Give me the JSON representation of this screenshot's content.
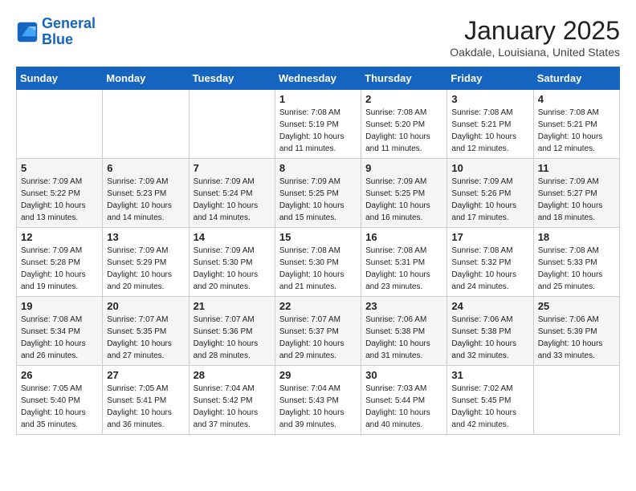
{
  "logo": {
    "line1": "General",
    "line2": "Blue"
  },
  "title": "January 2025",
  "location": "Oakdale, Louisiana, United States",
  "weekdays": [
    "Sunday",
    "Monday",
    "Tuesday",
    "Wednesday",
    "Thursday",
    "Friday",
    "Saturday"
  ],
  "weeks": [
    [
      {
        "day": "",
        "sunrise": "",
        "sunset": "",
        "daylight": ""
      },
      {
        "day": "",
        "sunrise": "",
        "sunset": "",
        "daylight": ""
      },
      {
        "day": "",
        "sunrise": "",
        "sunset": "",
        "daylight": ""
      },
      {
        "day": "1",
        "sunrise": "Sunrise: 7:08 AM",
        "sunset": "Sunset: 5:19 PM",
        "daylight": "Daylight: 10 hours and 11 minutes."
      },
      {
        "day": "2",
        "sunrise": "Sunrise: 7:08 AM",
        "sunset": "Sunset: 5:20 PM",
        "daylight": "Daylight: 10 hours and 11 minutes."
      },
      {
        "day": "3",
        "sunrise": "Sunrise: 7:08 AM",
        "sunset": "Sunset: 5:21 PM",
        "daylight": "Daylight: 10 hours and 12 minutes."
      },
      {
        "day": "4",
        "sunrise": "Sunrise: 7:08 AM",
        "sunset": "Sunset: 5:21 PM",
        "daylight": "Daylight: 10 hours and 12 minutes."
      }
    ],
    [
      {
        "day": "5",
        "sunrise": "Sunrise: 7:09 AM",
        "sunset": "Sunset: 5:22 PM",
        "daylight": "Daylight: 10 hours and 13 minutes."
      },
      {
        "day": "6",
        "sunrise": "Sunrise: 7:09 AM",
        "sunset": "Sunset: 5:23 PM",
        "daylight": "Daylight: 10 hours and 14 minutes."
      },
      {
        "day": "7",
        "sunrise": "Sunrise: 7:09 AM",
        "sunset": "Sunset: 5:24 PM",
        "daylight": "Daylight: 10 hours and 14 minutes."
      },
      {
        "day": "8",
        "sunrise": "Sunrise: 7:09 AM",
        "sunset": "Sunset: 5:25 PM",
        "daylight": "Daylight: 10 hours and 15 minutes."
      },
      {
        "day": "9",
        "sunrise": "Sunrise: 7:09 AM",
        "sunset": "Sunset: 5:25 PM",
        "daylight": "Daylight: 10 hours and 16 minutes."
      },
      {
        "day": "10",
        "sunrise": "Sunrise: 7:09 AM",
        "sunset": "Sunset: 5:26 PM",
        "daylight": "Daylight: 10 hours and 17 minutes."
      },
      {
        "day": "11",
        "sunrise": "Sunrise: 7:09 AM",
        "sunset": "Sunset: 5:27 PM",
        "daylight": "Daylight: 10 hours and 18 minutes."
      }
    ],
    [
      {
        "day": "12",
        "sunrise": "Sunrise: 7:09 AM",
        "sunset": "Sunset: 5:28 PM",
        "daylight": "Daylight: 10 hours and 19 minutes."
      },
      {
        "day": "13",
        "sunrise": "Sunrise: 7:09 AM",
        "sunset": "Sunset: 5:29 PM",
        "daylight": "Daylight: 10 hours and 20 minutes."
      },
      {
        "day": "14",
        "sunrise": "Sunrise: 7:09 AM",
        "sunset": "Sunset: 5:30 PM",
        "daylight": "Daylight: 10 hours and 20 minutes."
      },
      {
        "day": "15",
        "sunrise": "Sunrise: 7:08 AM",
        "sunset": "Sunset: 5:30 PM",
        "daylight": "Daylight: 10 hours and 21 minutes."
      },
      {
        "day": "16",
        "sunrise": "Sunrise: 7:08 AM",
        "sunset": "Sunset: 5:31 PM",
        "daylight": "Daylight: 10 hours and 23 minutes."
      },
      {
        "day": "17",
        "sunrise": "Sunrise: 7:08 AM",
        "sunset": "Sunset: 5:32 PM",
        "daylight": "Daylight: 10 hours and 24 minutes."
      },
      {
        "day": "18",
        "sunrise": "Sunrise: 7:08 AM",
        "sunset": "Sunset: 5:33 PM",
        "daylight": "Daylight: 10 hours and 25 minutes."
      }
    ],
    [
      {
        "day": "19",
        "sunrise": "Sunrise: 7:08 AM",
        "sunset": "Sunset: 5:34 PM",
        "daylight": "Daylight: 10 hours and 26 minutes."
      },
      {
        "day": "20",
        "sunrise": "Sunrise: 7:07 AM",
        "sunset": "Sunset: 5:35 PM",
        "daylight": "Daylight: 10 hours and 27 minutes."
      },
      {
        "day": "21",
        "sunrise": "Sunrise: 7:07 AM",
        "sunset": "Sunset: 5:36 PM",
        "daylight": "Daylight: 10 hours and 28 minutes."
      },
      {
        "day": "22",
        "sunrise": "Sunrise: 7:07 AM",
        "sunset": "Sunset: 5:37 PM",
        "daylight": "Daylight: 10 hours and 29 minutes."
      },
      {
        "day": "23",
        "sunrise": "Sunrise: 7:06 AM",
        "sunset": "Sunset: 5:38 PM",
        "daylight": "Daylight: 10 hours and 31 minutes."
      },
      {
        "day": "24",
        "sunrise": "Sunrise: 7:06 AM",
        "sunset": "Sunset: 5:38 PM",
        "daylight": "Daylight: 10 hours and 32 minutes."
      },
      {
        "day": "25",
        "sunrise": "Sunrise: 7:06 AM",
        "sunset": "Sunset: 5:39 PM",
        "daylight": "Daylight: 10 hours and 33 minutes."
      }
    ],
    [
      {
        "day": "26",
        "sunrise": "Sunrise: 7:05 AM",
        "sunset": "Sunset: 5:40 PM",
        "daylight": "Daylight: 10 hours and 35 minutes."
      },
      {
        "day": "27",
        "sunrise": "Sunrise: 7:05 AM",
        "sunset": "Sunset: 5:41 PM",
        "daylight": "Daylight: 10 hours and 36 minutes."
      },
      {
        "day": "28",
        "sunrise": "Sunrise: 7:04 AM",
        "sunset": "Sunset: 5:42 PM",
        "daylight": "Daylight: 10 hours and 37 minutes."
      },
      {
        "day": "29",
        "sunrise": "Sunrise: 7:04 AM",
        "sunset": "Sunset: 5:43 PM",
        "daylight": "Daylight: 10 hours and 39 minutes."
      },
      {
        "day": "30",
        "sunrise": "Sunrise: 7:03 AM",
        "sunset": "Sunset: 5:44 PM",
        "daylight": "Daylight: 10 hours and 40 minutes."
      },
      {
        "day": "31",
        "sunrise": "Sunrise: 7:02 AM",
        "sunset": "Sunset: 5:45 PM",
        "daylight": "Daylight: 10 hours and 42 minutes."
      },
      {
        "day": "",
        "sunrise": "",
        "sunset": "",
        "daylight": ""
      }
    ]
  ]
}
